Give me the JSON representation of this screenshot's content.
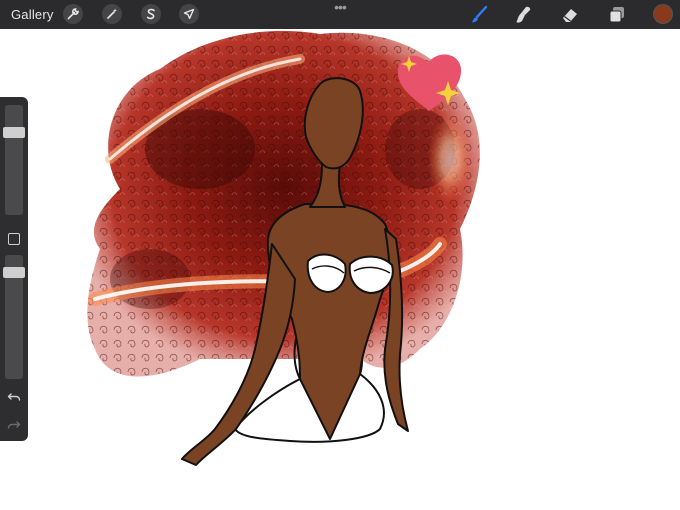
{
  "toolbar": {
    "gallery_label": "Gallery",
    "left_tools": [
      {
        "name": "actions",
        "icon": "wrench-icon"
      },
      {
        "name": "adjustments",
        "icon": "magic-wand-icon"
      },
      {
        "name": "selection",
        "icon": "selection-s-icon"
      },
      {
        "name": "transform",
        "icon": "arrow-cursor-icon"
      }
    ],
    "more_label": "•••",
    "right_tools": [
      {
        "name": "brush",
        "icon": "brush-icon",
        "active": true
      },
      {
        "name": "smudge",
        "icon": "smudge-icon"
      },
      {
        "name": "eraser",
        "icon": "eraser-icon"
      },
      {
        "name": "layers",
        "icon": "layers-icon"
      }
    ],
    "current_color": "#8a3a1c",
    "accent_color": "#2f7ef5"
  },
  "sidebar": {
    "brush_size_slider": {
      "icon": "size-slider-icon"
    },
    "modify_button": {
      "icon": "square-icon"
    },
    "opacity_slider": {
      "icon": "opacity-slider-icon"
    },
    "undo": {
      "icon": "undo-icon"
    },
    "redo": {
      "icon": "redo-icon",
      "enabled": false
    }
  },
  "canvas": {
    "artwork": "illustration",
    "colors": {
      "hair": "#8b1a12",
      "glow": "#ff7a3a",
      "skin": "#7a4424",
      "heart": "#e8526b",
      "sparkle": "#f3d23c"
    }
  }
}
